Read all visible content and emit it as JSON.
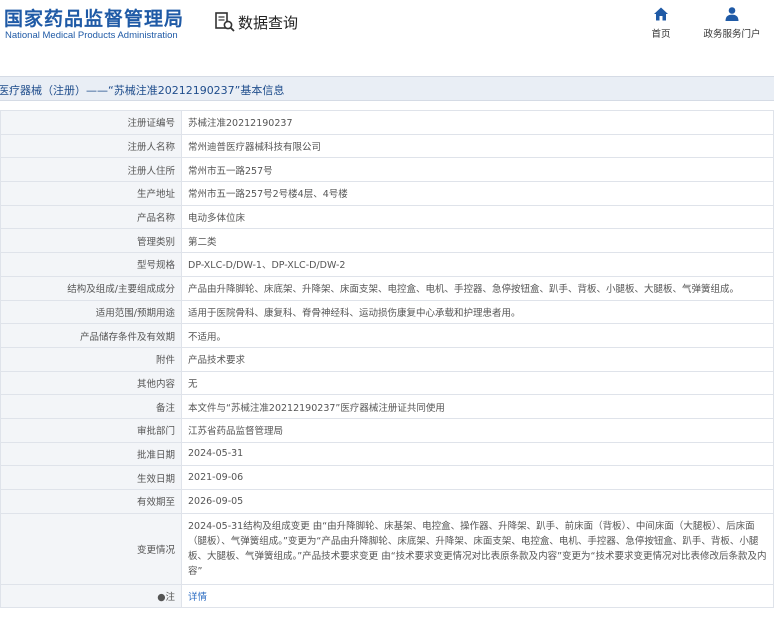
{
  "header": {
    "logo_cn": "国家药品监督管理局",
    "logo_en": "National Medical Products Administration",
    "query_icon": "search-document-icon",
    "query_label": "数据查询",
    "nav": [
      {
        "label": "首页",
        "icon": "home-icon"
      },
      {
        "label": "政务服务门户",
        "icon": "user-icon"
      }
    ]
  },
  "page_title": "医疗器械（注册）——“苏械注准20212190237”基本信息",
  "rows": [
    {
      "label": "注册证编号",
      "value": "苏械注准20212190237"
    },
    {
      "label": "注册人名称",
      "value": "常州迪普医疗器械科技有限公司"
    },
    {
      "label": "注册人住所",
      "value": "常州市五一路257号"
    },
    {
      "label": "生产地址",
      "value": "常州市五一路257号2号楼4层、4号楼"
    },
    {
      "label": "产品名称",
      "value": "电动多体位床"
    },
    {
      "label": "管理类别",
      "value": "第二类"
    },
    {
      "label": "型号规格",
      "value": "DP-XLC-D/DW-1、DP-XLC-D/DW-2"
    },
    {
      "label": "结构及组成/主要组成成分",
      "value": "产品由升降脚轮、床底架、升降架、床面支架、电控盒、电机、手控器、急停按钮盒、趴手、背板、小腿板、大腿板、气弹簧组成。"
    },
    {
      "label": "适用范围/预期用途",
      "value": "适用于医院骨科、康复科、脊骨神经科、运动损伤康复中心承载和护理患者用。"
    },
    {
      "label": "产品储存条件及有效期",
      "value": "不适用。"
    },
    {
      "label": "附件",
      "value": "产品技术要求"
    },
    {
      "label": "其他内容",
      "value": "无"
    },
    {
      "label": "备注",
      "value": "本文件与“苏械注准20212190237”医疗器械注册证共同使用"
    },
    {
      "label": "审批部门",
      "value": "江苏省药品监督管理局"
    },
    {
      "label": "批准日期",
      "value": "2024-05-31"
    },
    {
      "label": "生效日期",
      "value": "2021-09-06"
    },
    {
      "label": "有效期至",
      "value": "2026-09-05"
    },
    {
      "label": "变更情况",
      "value": "2024-05-31结构及组成变更 由“由升降脚轮、床基架、电控盒、操作器、升降架、趴手、前床面（背板）、中间床面（大腿板）、后床面（腿板）、气弹簧组成。”变更为“产品由升降脚轮、床底架、升降架、床面支架、电控盒、电机、手控器、急停按钮盒、趴手、背板、小腿板、大腿板、气弹簧组成。”产品技术要求变更 由“技术要求变更情况对比表原条款及内容”变更为“技术要求变更情况对比表修改后条款及内容”"
    },
    {
      "label": "●注",
      "value": "详情",
      "link": true
    }
  ]
}
